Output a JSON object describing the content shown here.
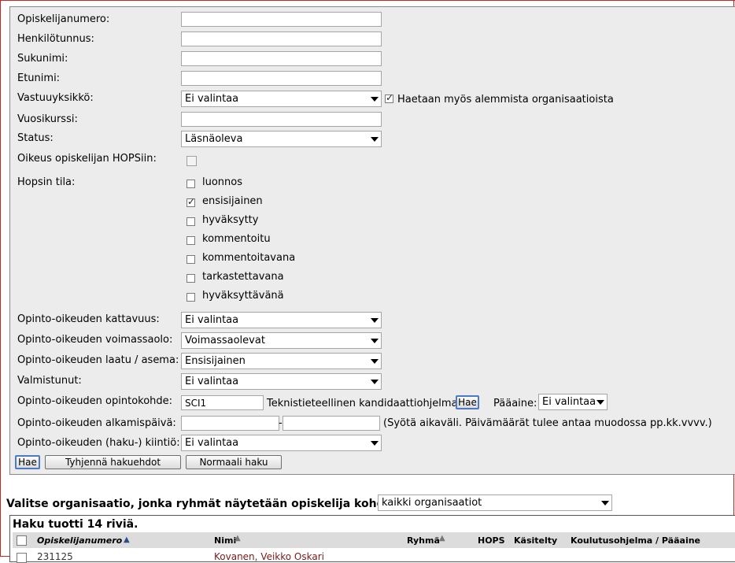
{
  "form": {
    "fields": {
      "student_number": {
        "label": "Opiskelijanumero:",
        "value": ""
      },
      "ssn": {
        "label": "Henkilötunnus:",
        "value": ""
      },
      "last_name": {
        "label": "Sukunimi:",
        "value": ""
      },
      "first_name": {
        "label": "Etunimi:",
        "value": ""
      },
      "responsible_unit": {
        "label": "Vastuuyksikkö:",
        "value": "Ei valintaa"
      },
      "include_sub_orgs": {
        "label": "Haetaan myös alemmista organisaatioista",
        "checked": true
      },
      "year_course": {
        "label": "Vuosikurssi:",
        "value": ""
      },
      "status": {
        "label": "Status:",
        "value": "Läsnäoleva"
      },
      "hops_right": {
        "label": "Oikeus opiskelijan HOPSiin:",
        "checked": false
      },
      "hops_state": {
        "label": "Hopsin tila:",
        "options": [
          {
            "label": "luonnos",
            "checked": false
          },
          {
            "label": "ensisijainen",
            "checked": true
          },
          {
            "label": "hyväksytty",
            "checked": false
          },
          {
            "label": "kommentoitu",
            "checked": false
          },
          {
            "label": "kommentoitavana",
            "checked": false
          },
          {
            "label": "tarkastettavana",
            "checked": false
          },
          {
            "label": "hyväksyttävänä",
            "checked": false
          }
        ]
      },
      "coverage": {
        "label": "Opinto-oikeuden kattavuus:",
        "value": "Ei valintaa"
      },
      "validity": {
        "label": "Opinto-oikeuden voimassaolo:",
        "value": "Voimassaolevat"
      },
      "quality": {
        "label": "Opinto-oikeuden laatu / asema:",
        "value": "Ensisijainen"
      },
      "graduated": {
        "label": "Valmistunut:",
        "value": "Ei valintaa"
      },
      "target": {
        "label": "Opinto-oikeuden opintokohde:",
        "code": "SCI1",
        "name": "Teknistieteellinen kandidaattiohjelma",
        "search_button": "Hae",
        "major_label": "Pääaine:",
        "major_value": "Ei valintaa"
      },
      "start_date": {
        "label": "Opinto-oikeuden alkamispäivä:",
        "from": "",
        "separator": "-",
        "to": "",
        "hint": "(Syötä aikaväli. Päivämäärät tulee antaa muodossa pp.kk.vvvv.)"
      },
      "quota": {
        "label": "Opinto-oikeuden (haku-) kiintiö:",
        "value": "Ei valintaa"
      }
    },
    "buttons": {
      "search": "Hae",
      "clear": "Tyhjennä hakuehdot",
      "normal": "Normaali haku"
    }
  },
  "org_select": {
    "label": "Valitse organisaatio, jonka ryhmät näytetään opiskelija kohdalla",
    "value": "kaikki organisaatiot"
  },
  "results": {
    "title": "Haku tuotti 14 riviä.",
    "columns": [
      "Opiskelijanumero",
      "Nimi",
      "Ryhmä",
      "HOPS",
      "Käsitelty",
      "Koulutusohjelma / Pääaine"
    ],
    "sort_icon": "▲",
    "first_row": {
      "student_number": "231125",
      "name": "Kovanen, Veikko Oskari"
    }
  }
}
